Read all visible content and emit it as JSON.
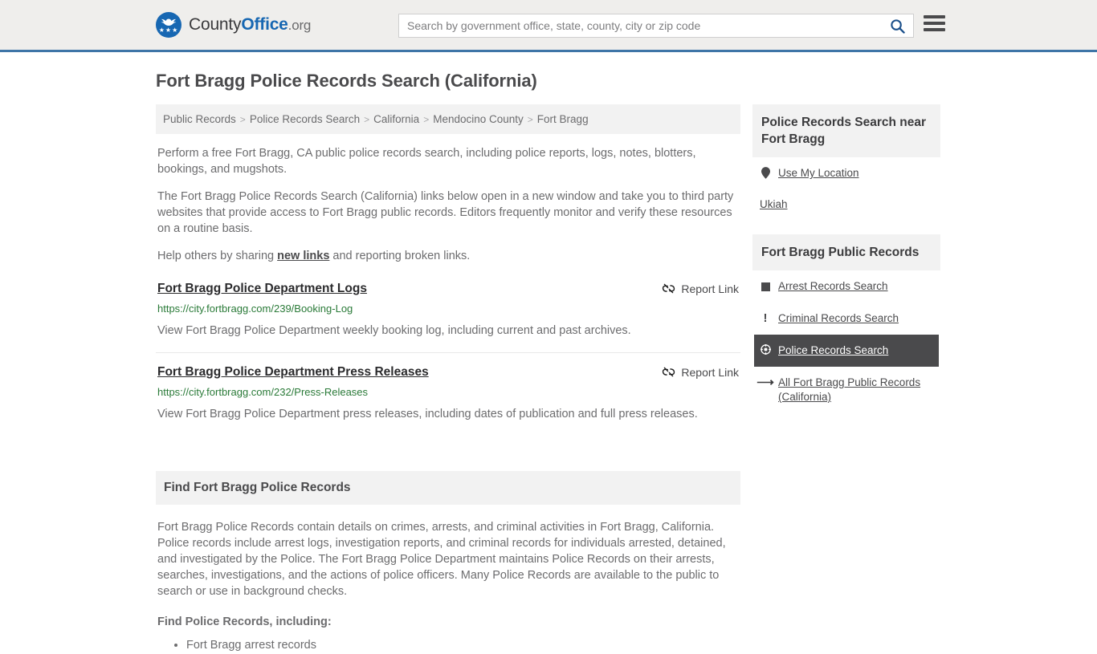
{
  "header": {
    "brand": {
      "county": "County",
      "office": "Office",
      "org": ".org",
      "logo_icon": "eagle-seal-logo",
      "stars": "★★★"
    },
    "search": {
      "placeholder": "Search by government office, state, county, city or zip code",
      "value": "",
      "button_icon": "search-icon"
    },
    "menu_icon": "hamburger-menu-icon",
    "accent_color": "#3e75a7",
    "background_color": "#efeeec"
  },
  "page_title": "Fort Bragg Police Records Search (California)",
  "breadcrumb": {
    "separator": ">",
    "items": [
      "Public Records",
      "Police Records Search",
      "California",
      "Mendocino County",
      "Fort Bragg"
    ]
  },
  "intro": {
    "p1": "Perform a free Fort Bragg, CA public police records search, including police reports, logs, notes, blotters, bookings, and mugshots.",
    "p2": "The Fort Bragg Police Records Search (California) links below open in a new window and take you to third party websites that provide access to Fort Bragg public records. Editors frequently monitor and verify these resources on a routine basis.",
    "p3_before": "Help others by sharing ",
    "p3_link": "new links",
    "p3_after": " and reporting broken links."
  },
  "results": {
    "report_label": "Report Link",
    "report_icon": "broken-link-icon",
    "items": [
      {
        "title": "Fort Bragg Police Department Logs",
        "url": "https://city.fortbragg.com/239/Booking-Log",
        "description": "View Fort Bragg Police Department weekly booking log, including current and past archives."
      },
      {
        "title": "Fort Bragg Police Department Press Releases",
        "url": "https://city.fortbragg.com/232/Press-Releases",
        "description": "View Fort Bragg Police Department press releases, including dates of publication and full press releases."
      }
    ]
  },
  "find_section": {
    "heading": "Find Fort Bragg Police Records",
    "body": "Fort Bragg Police Records contain details on crimes, arrests, and criminal activities in Fort Bragg, California. Police records include arrest logs, investigation reports, and criminal records for individuals arrested, detained, and investigated by the Police. The Fort Bragg Police Department maintains Police Records on their arrests, searches, investigations, and the actions of police officers. Many Police Records are available to the public to search or use in background checks.",
    "subheading": "Find Police Records, including:",
    "list": [
      "Fort Bragg arrest records"
    ]
  },
  "sidebar": {
    "near_block": {
      "heading": "Police Records Search near Fort Bragg",
      "use_my_location": {
        "label": "Use My Location",
        "icon": "map-pin-icon"
      },
      "nearby": [
        "Ukiah"
      ]
    },
    "public_records_block": {
      "heading": "Fort Bragg Public Records",
      "items": [
        {
          "label": "Arrest Records Search",
          "icon": "square-icon",
          "active": false
        },
        {
          "label": "Criminal Records Search",
          "icon": "exclamation-icon",
          "active": false
        },
        {
          "label": "Police Records Search",
          "icon": "police-badge-icon",
          "active": true
        },
        {
          "label": "All Fort Bragg Public Records (California)",
          "icon": "arrow-right-icon",
          "active": false
        }
      ],
      "active_background": "#4a4a4c"
    }
  }
}
